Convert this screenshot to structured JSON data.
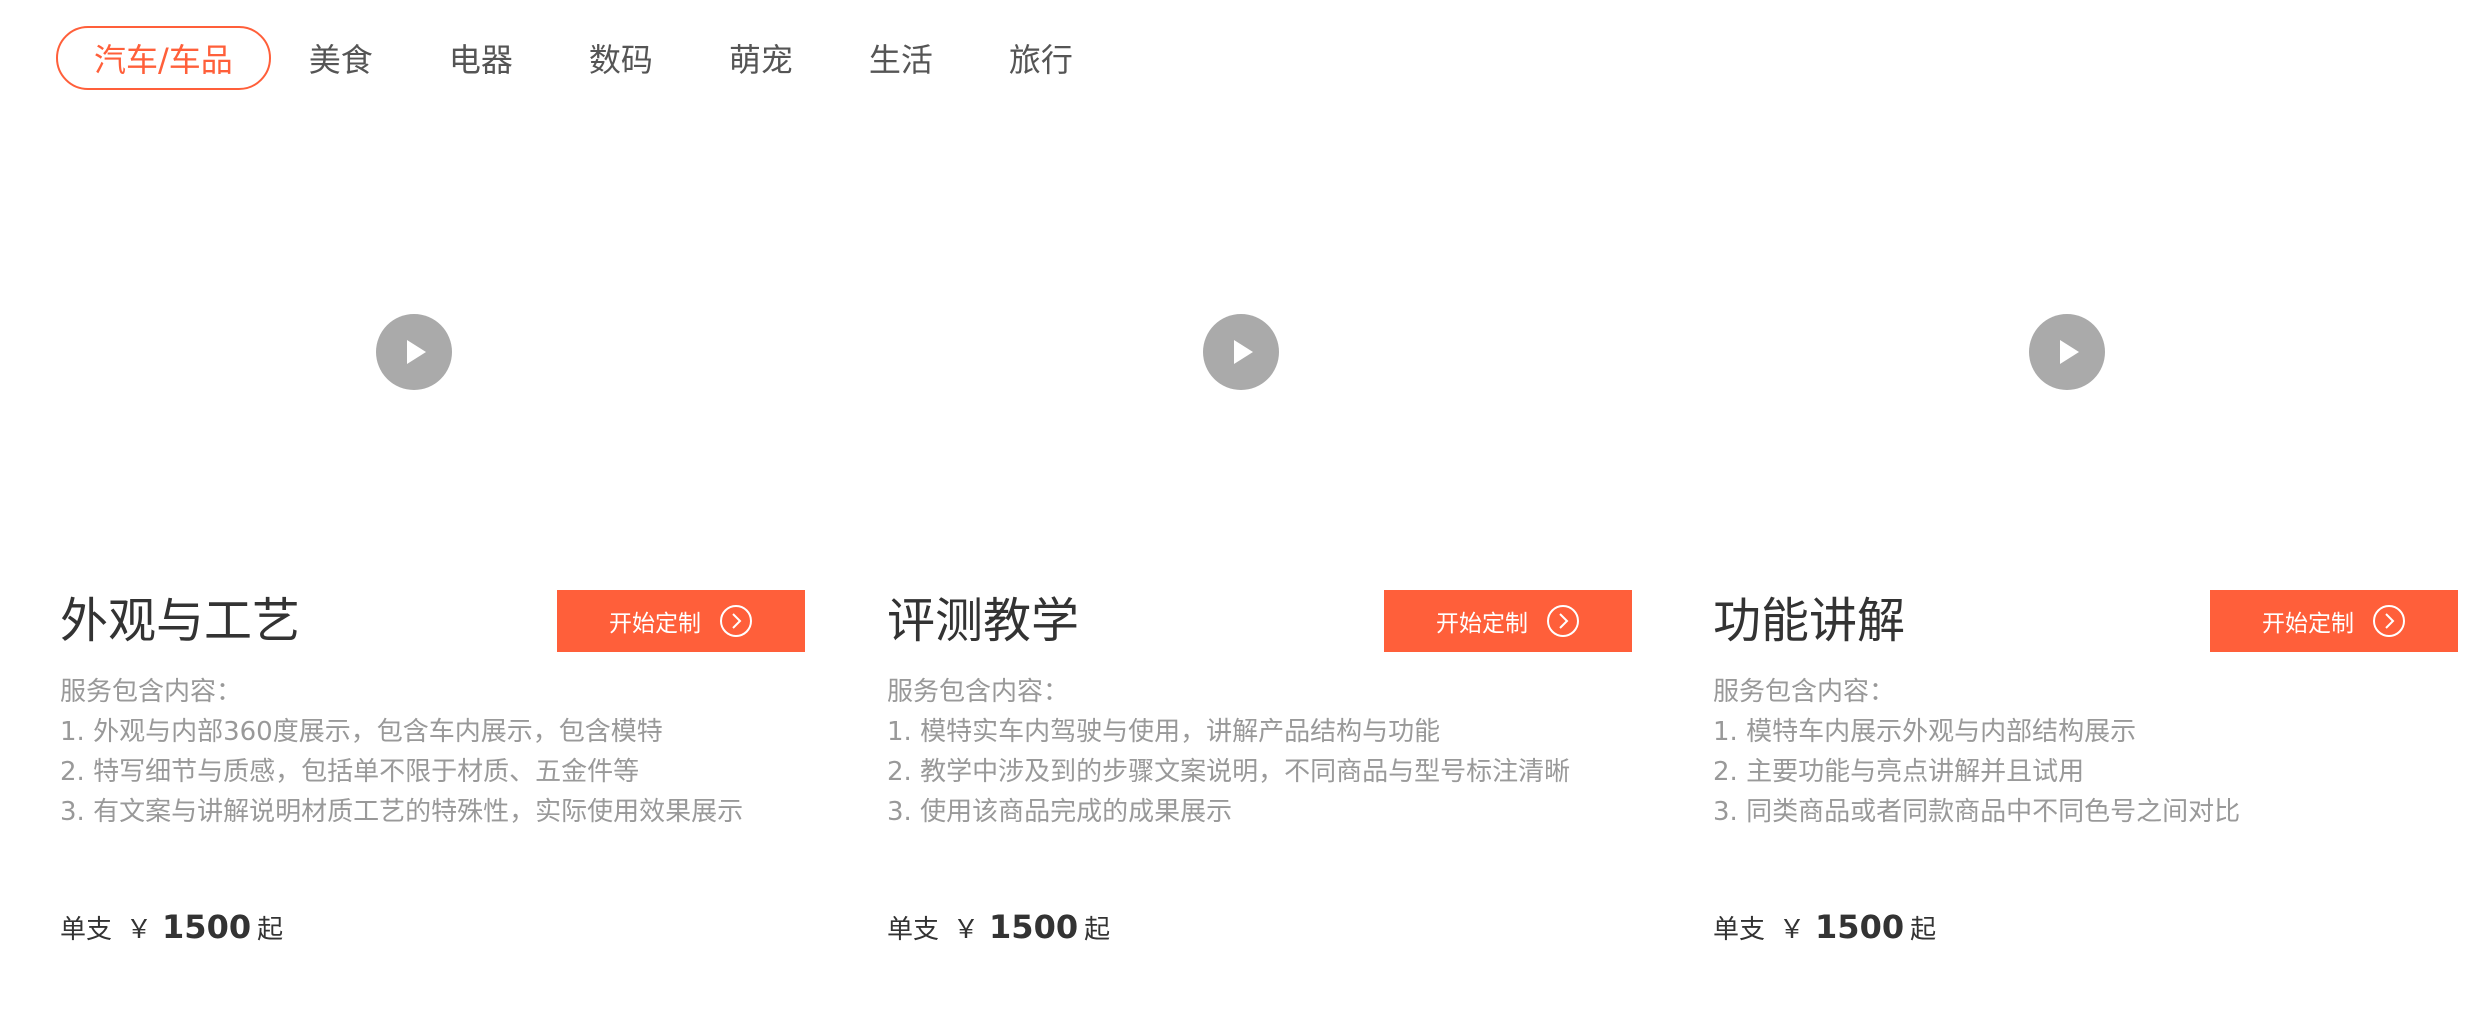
{
  "tabs": [
    {
      "label": "汽车/车品",
      "active": true
    },
    {
      "label": "美食",
      "active": false
    },
    {
      "label": "电器",
      "active": false
    },
    {
      "label": "数码",
      "active": false
    },
    {
      "label": "萌宠",
      "active": false
    },
    {
      "label": "生活",
      "active": false
    },
    {
      "label": "旅行",
      "active": false
    }
  ],
  "colors": {
    "accent": "#ff5f3a",
    "play_button": "#aaaaaa",
    "muted_text": "#999999",
    "primary_text": "#333333"
  },
  "icons": {
    "play": "play-icon",
    "arrow": "chevron-right-circle-icon"
  },
  "cards": [
    {
      "title": "外观与工艺",
      "button_label": "开始定制",
      "desc_heading": "服务包含内容：",
      "desc_items": [
        "1. 外观与内部360度展示，包含车内展示，包含模特",
        "2. 特写细节与质感，包括单不限于材质、五金件等",
        "3. 有文案与讲解说明材质工艺的特殊性，实际使用效果展示"
      ],
      "price_unit": "单支",
      "price_currency": "￥",
      "price_value": "1500",
      "price_suffix": "起"
    },
    {
      "title": "评测教学",
      "button_label": "开始定制",
      "desc_heading": "服务包含内容：",
      "desc_items": [
        "1. 模特实车内驾驶与使用，讲解产品结构与功能",
        "2. 教学中涉及到的步骤文案说明，不同商品与型号标注清晰",
        "3. 使用该商品完成的成果展示"
      ],
      "price_unit": "单支",
      "price_currency": "￥",
      "price_value": "1500",
      "price_suffix": "起"
    },
    {
      "title": "功能讲解",
      "button_label": "开始定制",
      "desc_heading": "服务包含内容：",
      "desc_items": [
        "1. 模特车内展示外观与内部结构展示",
        "2. 主要功能与亮点讲解并且试用",
        "3. 同类商品或者同款商品中不同色号之间对比"
      ],
      "price_unit": "单支",
      "price_currency": "￥",
      "price_value": "1500",
      "price_suffix": "起"
    }
  ]
}
